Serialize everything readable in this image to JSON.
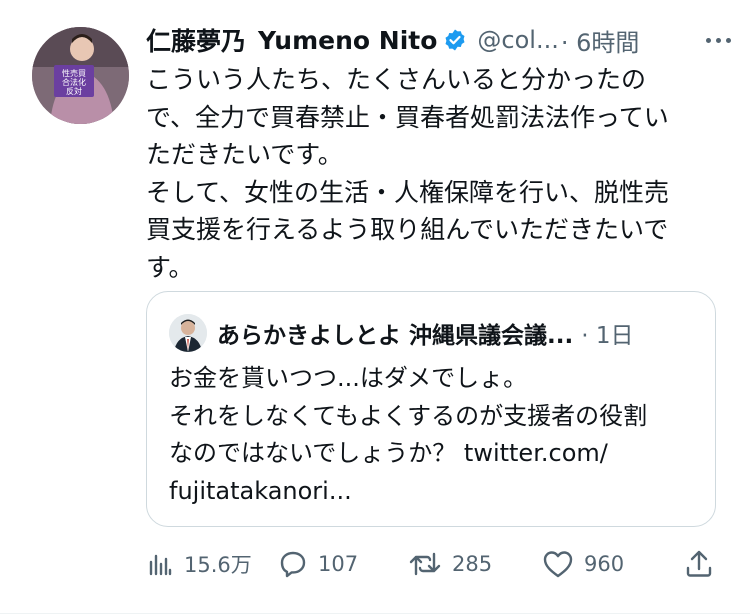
{
  "tweet": {
    "author": {
      "name": "仁藤夢乃",
      "name_en": "Yumeno Nito",
      "handle": "@col...",
      "time": "· 6時間",
      "avatar_sign": [
        "性売買",
        "合法化",
        "反対"
      ]
    },
    "body_lines": [
      "こういう人たち、たくさんいると分かったの",
      "で、全力で買春禁止・買春者処罰法法作ってい",
      "ただきたいです。",
      "そして、女性の生活・人権保障を行い、脱性売",
      "買支援を行えるよう取り組んでいただきたいで",
      "す。"
    ],
    "quote": {
      "name": "あらかきよしとよ 沖縄県議会議...",
      "time": "· 1日",
      "text_lines": [
        "お金を貰いつつ...はダメでしょ。",
        "それをしなくてもよくするのが支援者の役割",
        "なのではないでしょうか？ twitter.com/",
        "fujitatakanori..."
      ]
    },
    "actions": {
      "views": "15.6万",
      "replies": "107",
      "retweets": "285",
      "likes": "960"
    }
  },
  "colors": {
    "text": "#0f1419",
    "secondary": "#536471",
    "verified": "#1d9bf0",
    "border": "#cfd9de"
  }
}
